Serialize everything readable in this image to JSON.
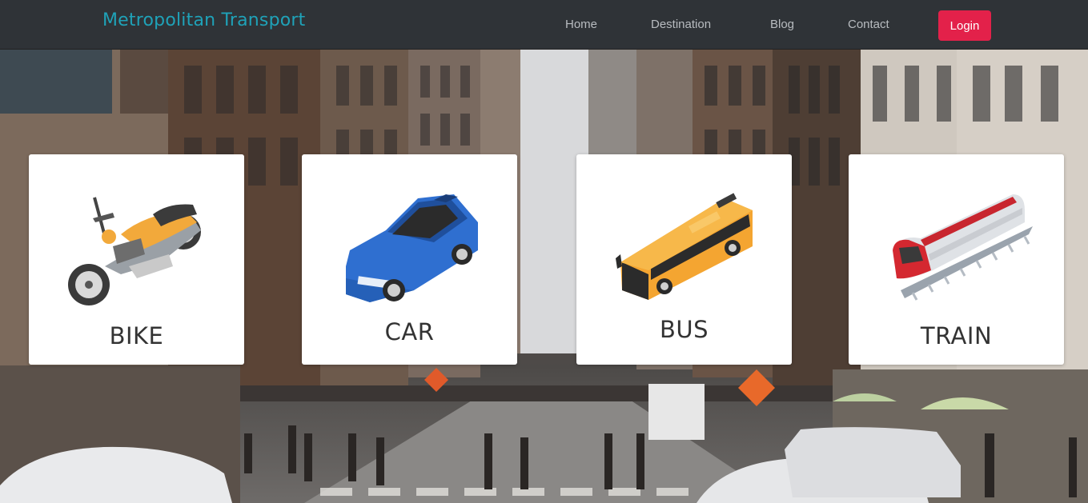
{
  "header": {
    "brand": "Metropolitan Transport",
    "nav": [
      "Home",
      "Destination",
      "Blog",
      "Contact"
    ],
    "login_label": "Login"
  },
  "cards": [
    {
      "label": "BIKE",
      "icon": "motorcycle-icon"
    },
    {
      "label": "CAR",
      "icon": "car-icon"
    },
    {
      "label": "BUS",
      "icon": "bus-icon"
    },
    {
      "label": "TRAIN",
      "icon": "train-icon"
    }
  ],
  "colors": {
    "navbar": "#2f3337",
    "brand": "#1fa2b8",
    "login": "#e3214a",
    "card_text": "#333333"
  }
}
